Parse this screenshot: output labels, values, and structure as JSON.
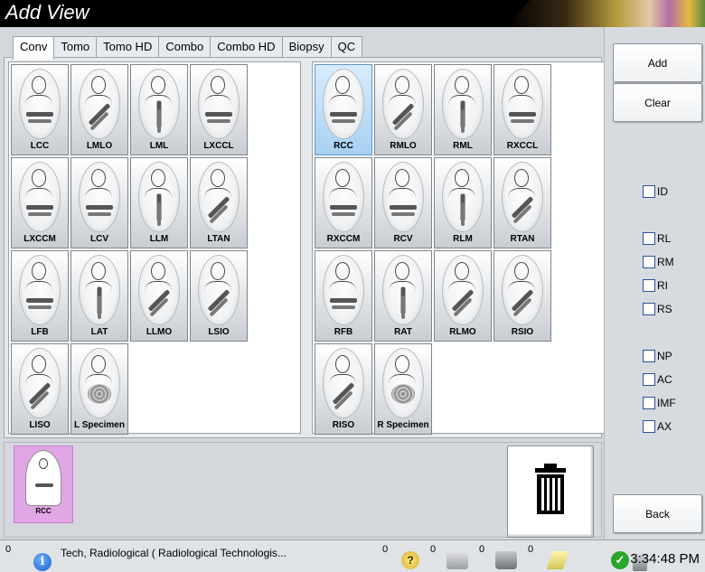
{
  "window": {
    "title": "Add View"
  },
  "tabs": [
    {
      "label": "Conv",
      "active": true
    },
    {
      "label": "Tomo",
      "active": false
    },
    {
      "label": "Tomo HD",
      "active": false
    },
    {
      "label": "Combo",
      "active": false
    },
    {
      "label": "Combo HD",
      "active": false
    },
    {
      "label": "Biopsy",
      "active": false
    },
    {
      "label": "QC",
      "active": false
    }
  ],
  "left_views": [
    "LCC",
    "LMLO",
    "LML",
    "LXCCL",
    "LXCCM",
    "LCV",
    "LLM",
    "LTAN",
    "LFB",
    "LAT",
    "LLMO",
    "LSIO",
    "LISO",
    "L Specimen"
  ],
  "right_views": [
    "RCC",
    "RMLO",
    "RML",
    "RXCCL",
    "RXCCM",
    "RCV",
    "RLM",
    "RTAN",
    "RFB",
    "RAT",
    "RLMO",
    "RSIO",
    "RISO",
    "R Specimen"
  ],
  "selected_view": "RCC",
  "added_views": [
    "RCC"
  ],
  "sidebar": {
    "add_label": "Add",
    "clear_label": "Clear",
    "back_label": "Back",
    "modifiers_group1": [
      "ID"
    ],
    "modifiers_group2": [
      "RL",
      "RM",
      "RI",
      "RS"
    ],
    "modifiers_group3": [
      "NP",
      "AC",
      "IMF",
      "AX"
    ]
  },
  "status": {
    "alert_count": "0",
    "user": "Tech, Radiological ( Radiological Technologis...",
    "help_count": "0",
    "tray_count": "0",
    "print_count": "0",
    "output_count": "0",
    "time": "3:34:48 PM"
  }
}
